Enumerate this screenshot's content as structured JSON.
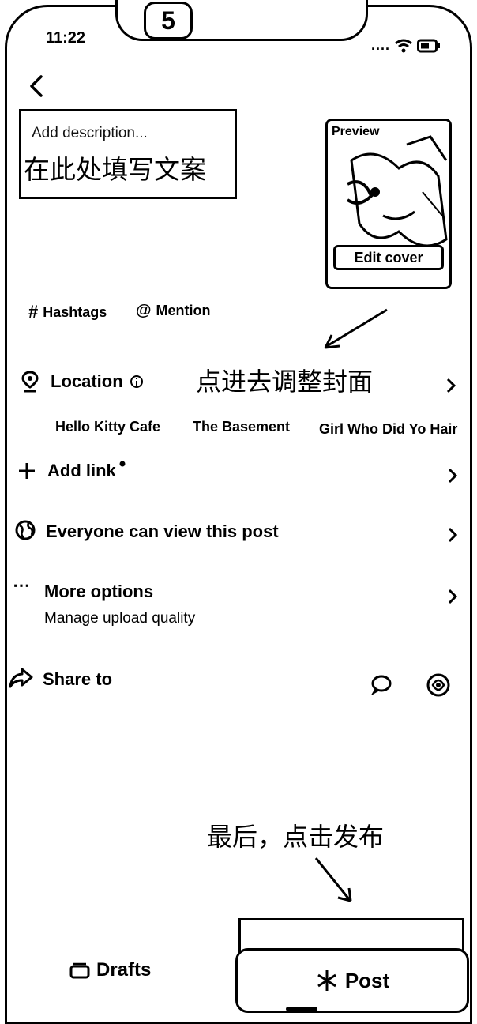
{
  "status_bar": {
    "time": "11:22",
    "signal_dots": "....",
    "step_number": "5"
  },
  "description": {
    "placeholder": "Add description...",
    "annotation": "在此处填写文案"
  },
  "cover": {
    "preview_label": "Preview",
    "edit_label": "Edit cover"
  },
  "tags": {
    "hashtags_label": "Hashtags",
    "mention_label": "Mention"
  },
  "annotations": {
    "cover_hint": "点进去调整封面",
    "post_hint": "最后，点击发布"
  },
  "location": {
    "label": "Location",
    "suggestions": [
      "Hello Kitty Cafe",
      "The Basement",
      "Girl Who Did Yo Hair"
    ]
  },
  "add_link": {
    "label": "Add link"
  },
  "privacy": {
    "label": "Everyone can view this post"
  },
  "more_options": {
    "label": "More options",
    "sub_label": "Manage upload quality"
  },
  "share": {
    "label": "Share to"
  },
  "footer": {
    "drafts_label": "Drafts",
    "post_label": "Post"
  }
}
